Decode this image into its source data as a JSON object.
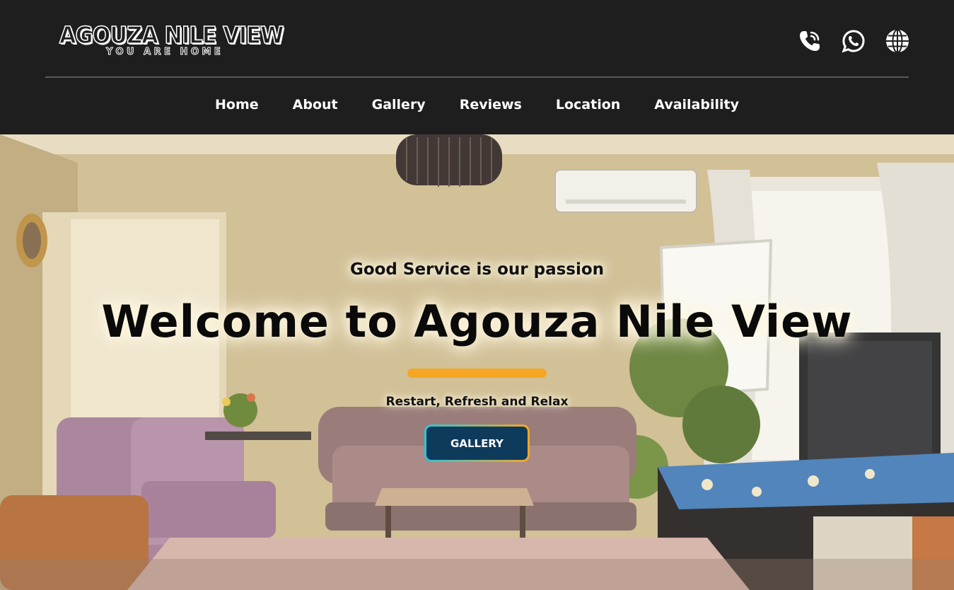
{
  "header": {
    "logo": {
      "title": "AGOUZA NILE VIEW",
      "subtitle": "YOU ARE HOME"
    },
    "icons": [
      {
        "name": "phone-icon",
        "label": "Phone"
      },
      {
        "name": "whatsapp-icon",
        "label": "WhatsApp"
      },
      {
        "name": "globe-icon",
        "label": "Language"
      }
    ],
    "nav": [
      {
        "label": "Home"
      },
      {
        "label": "About"
      },
      {
        "label": "Gallery"
      },
      {
        "label": "Reviews"
      },
      {
        "label": "Location"
      },
      {
        "label": "Availability"
      }
    ]
  },
  "hero": {
    "tagline": "Good Service is our passion",
    "headline": "Welcome to Agouza Nile View",
    "subline": "Restart, Refresh and Relax",
    "button_label": "GALLERY",
    "background_description": "living room photo"
  },
  "colors": {
    "header_bg": "#1e1e1e",
    "accent_bar": "#f6a623",
    "button_bg": "#0e3a5c",
    "button_border_start": "#2ec4d8",
    "button_border_end": "#f6a623",
    "nav_text": "#ffffff"
  }
}
